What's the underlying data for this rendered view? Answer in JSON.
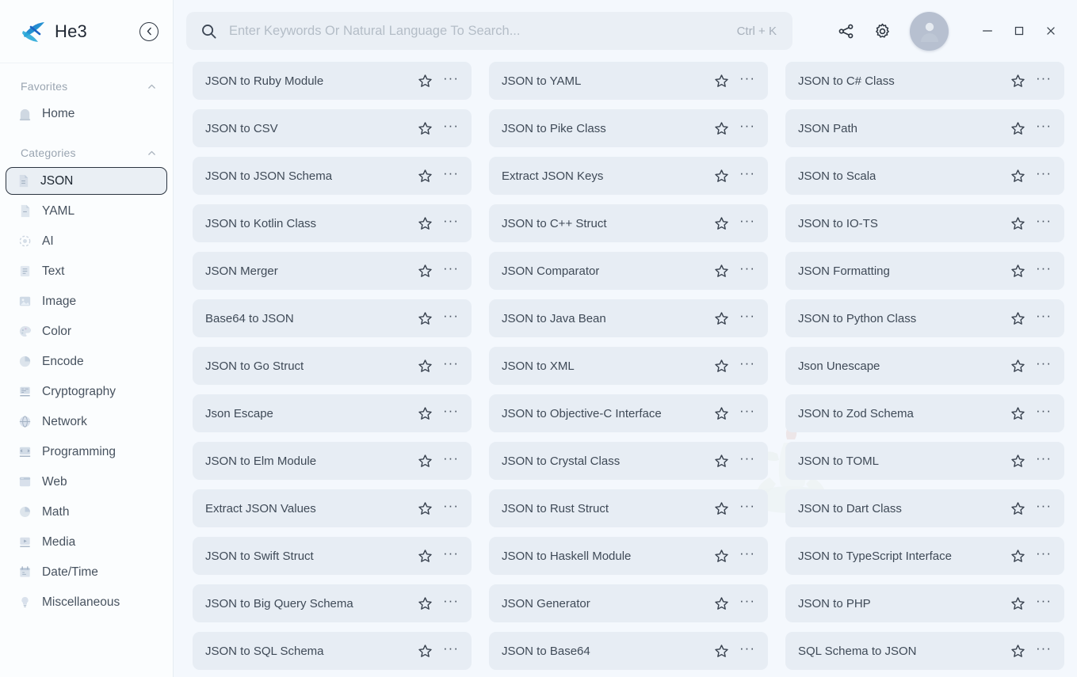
{
  "sidebar": {
    "brand": {
      "name": "He3",
      "logo_icon": "he3-logo-icon",
      "collapse_icon": "chevron-left-circle-icon"
    },
    "favorites": {
      "title": "Favorites",
      "toggle_icon": "chevron-up-icon",
      "items": [
        {
          "label": "Home",
          "icon": "home-icon"
        }
      ]
    },
    "categories": {
      "title": "Categories",
      "toggle_icon": "chevron-up-icon",
      "items": [
        {
          "label": "JSON",
          "icon": "file-json-icon",
          "selected": true
        },
        {
          "label": "YAML",
          "icon": "file-yaml-icon",
          "selected": false
        },
        {
          "label": "AI",
          "icon": "ai-sparkle-icon",
          "selected": false
        },
        {
          "label": "Text",
          "icon": "text-lines-icon",
          "selected": false
        },
        {
          "label": "Image",
          "icon": "image-icon",
          "selected": false
        },
        {
          "label": "Color",
          "icon": "color-palette-icon",
          "selected": false
        },
        {
          "label": "Encode",
          "icon": "encode-pie-icon",
          "selected": false
        },
        {
          "label": "Cryptography",
          "icon": "cryptography-icon",
          "selected": false
        },
        {
          "label": "Network",
          "icon": "network-globe-icon",
          "selected": false
        },
        {
          "label": "Programming",
          "icon": "programming-icon",
          "selected": false
        },
        {
          "label": "Web",
          "icon": "web-browser-icon",
          "selected": false
        },
        {
          "label": "Math",
          "icon": "math-chart-icon",
          "selected": false
        },
        {
          "label": "Media",
          "icon": "media-play-icon",
          "selected": false
        },
        {
          "label": "Date/Time",
          "icon": "calendar-icon",
          "selected": false
        },
        {
          "label": "Miscellaneous",
          "icon": "bulb-icon",
          "selected": false
        }
      ]
    }
  },
  "topbar": {
    "search": {
      "placeholder": "Enter Keywords Or Natural Language To Search...",
      "value": "",
      "icon": "search-icon",
      "shortcut": "Ctrl + K"
    },
    "actions": [
      {
        "name": "share-icon"
      },
      {
        "name": "gear-icon"
      }
    ],
    "avatar": {
      "name": "avatar",
      "icon": "user-icon"
    },
    "window_controls": [
      {
        "name": "minimize-button",
        "icon": "minimize-icon",
        "glyph": "–"
      },
      {
        "name": "maximize-button",
        "icon": "maximize-icon",
        "glyph": "□"
      },
      {
        "name": "close-button",
        "icon": "close-icon",
        "glyph": "✕"
      }
    ]
  },
  "main": {
    "card_icons": {
      "star": "star-outline-icon",
      "more": "more-horizontal-icon"
    },
    "more_glyph": "···",
    "tools": [
      "JSON to Ruby Module",
      "JSON to YAML",
      "JSON to C# Class",
      "JSON to CSV",
      "JSON to Pike Class",
      "JSON Path",
      "JSON to JSON Schema",
      "Extract JSON Keys",
      "JSON to Scala",
      "JSON to Kotlin Class",
      "JSON to C++ Struct",
      "JSON to IO-TS",
      "JSON Merger",
      "JSON Comparator",
      "JSON Formatting",
      "Base64 to JSON",
      "JSON to Java Bean",
      "JSON to Python Class",
      "JSON to Go Struct",
      "JSON to XML",
      "Json Unescape",
      "Json Escape",
      "JSON to Objective-C Interface",
      "JSON to Zod Schema",
      "JSON to Elm Module",
      "JSON to Crystal Class",
      "JSON to TOML",
      "Extract JSON Values",
      "JSON to Rust Struct",
      "JSON to Dart Class",
      "JSON to Swift Struct",
      "JSON to Haskell Module",
      "JSON to TypeScript Interface",
      "JSON to Big Query Schema",
      "JSON Generator",
      "JSON to PHP",
      "JSON to SQL Schema",
      "JSON to Base64",
      "SQL Schema to JSON"
    ]
  },
  "colors": {
    "page_bg": "#f4f8fd",
    "sidebar_bg": "#fbfdfe",
    "card_bg": "#e7edf4",
    "search_bg": "#eaeff5",
    "text_primary": "#3f4a57",
    "text_muted": "#9aa5b1",
    "accent": "#2ba7d8"
  }
}
